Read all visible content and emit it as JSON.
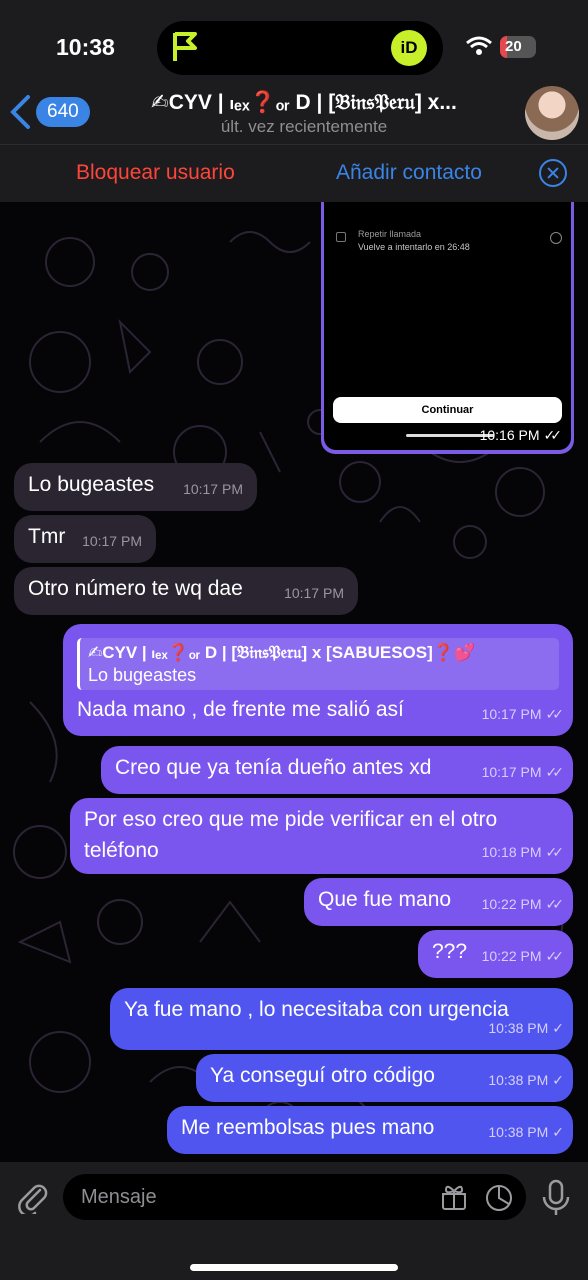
{
  "status_bar": {
    "time": "10:38",
    "battery": "20",
    "battery_level_pct": 20
  },
  "header": {
    "back_count": "640",
    "title": "✍︎CYV | ₗₑₓ❓ₒᵣ D | [𝔅𝔦𝔫𝔰𝔓𝔢𝔯𝔲] x...",
    "subtitle": "últ. vez recientemente"
  },
  "actions": {
    "block": "Bloquear usuario",
    "add_contact": "Añadir contacto"
  },
  "screenshot_message": {
    "retry_title": "Repetir llamada",
    "retry_sub": "Vuelve a intentarlo en 26:48",
    "continue": "Continuar",
    "time": "10:16 PM"
  },
  "messages": [
    {
      "text": "Lo bugeastes",
      "time": "10:17 PM",
      "dir": "in"
    },
    {
      "text": "Tmr",
      "time": "10:17 PM",
      "dir": "in"
    },
    {
      "text": "Otro número te wq dae",
      "time": "10:17 PM",
      "dir": "in"
    },
    {
      "reply_name": "✍︎CYV | ₗₑₓ❓ₒᵣ D | [𝔅𝔦𝔫𝔰𝔓𝔢𝔯𝔲] x [SABUESOS]❓💕",
      "reply_text": "Lo bugeastes",
      "text": "Nada mano , de frente me salió así",
      "time": "10:17 PM",
      "dir": "out"
    },
    {
      "text": "Creo que ya tenía dueño antes xd",
      "time": "10:17 PM",
      "dir": "out"
    },
    {
      "text": "Por eso creo que me pide verificar en el otro teléfono",
      "time": "10:18 PM",
      "dir": "out"
    },
    {
      "text": "Que fue mano",
      "time": "10:22 PM",
      "dir": "out"
    },
    {
      "text": "???",
      "time": "10:22 PM",
      "dir": "out"
    },
    {
      "text": "Ya fue mano , lo necesitaba con urgencia",
      "time": "10:38 PM",
      "dir": "out"
    },
    {
      "text": "Ya conseguí otro código",
      "time": "10:38 PM",
      "dir": "out"
    },
    {
      "text": "Me reembolsas pues mano",
      "time": "10:38 PM",
      "dir": "out"
    }
  ],
  "input": {
    "placeholder": "Mensaje"
  },
  "colors": {
    "accent": "#3a84e6",
    "danger": "#ff453a",
    "bubble_out": "#7a55ee",
    "bubble_out_late": "#4f55ee",
    "bubble_in": "#2a2530"
  }
}
